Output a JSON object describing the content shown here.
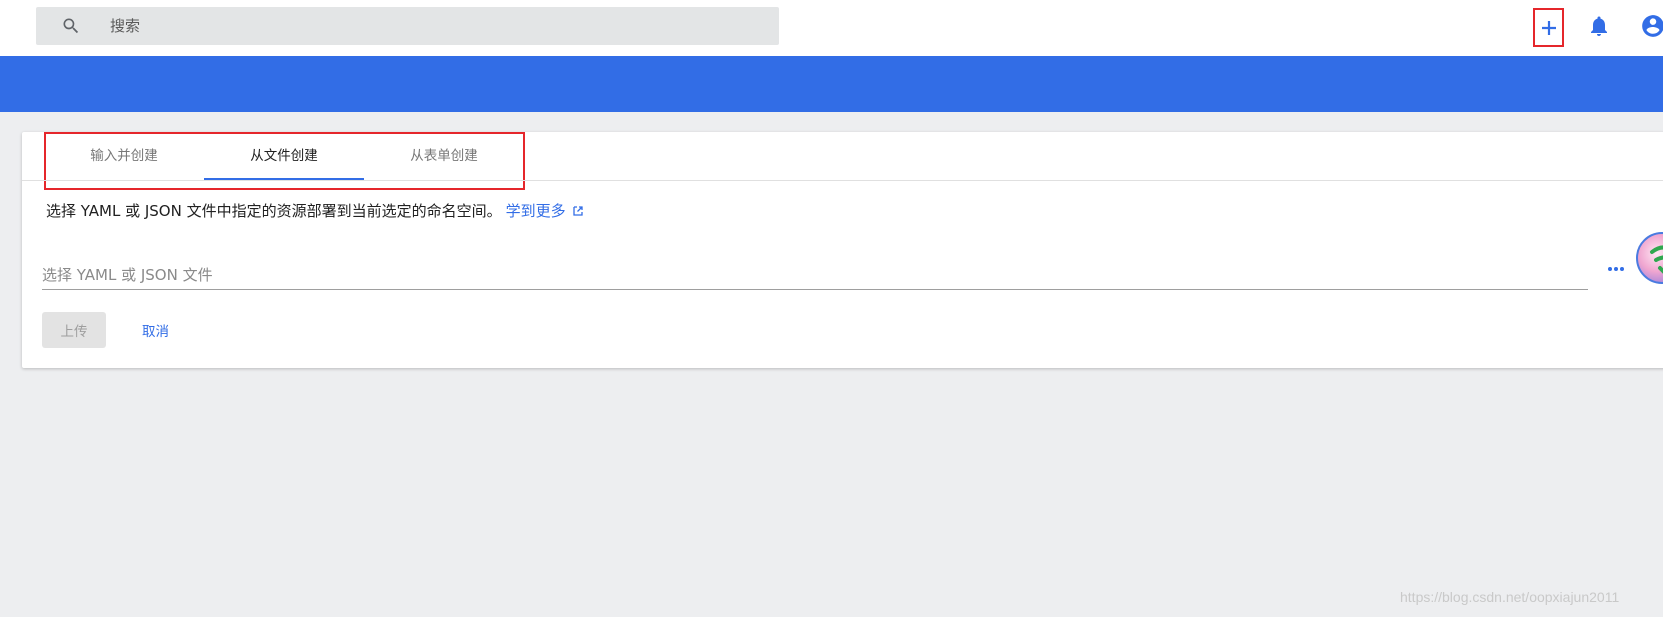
{
  "toolbar": {
    "search_placeholder": "搜索",
    "search_icon": "search-icon",
    "add_icon": "plus-icon",
    "notifications_icon": "bell-icon",
    "account_icon": "account-circle-icon"
  },
  "colors": {
    "brand": "#326de6",
    "highlight": "#e5262b",
    "background": "#edeef0"
  },
  "tabs": [
    {
      "label": "输入并创建",
      "active": false
    },
    {
      "label": "从文件创建",
      "active": true
    },
    {
      "label": "从表单创建",
      "active": false
    }
  ],
  "file_form": {
    "description": "选择 YAML 或 JSON 文件中指定的资源部署到当前选定的命名空间。",
    "learn_more": "学到更多",
    "file_placeholder": "选择 YAML 或 JSON 文件",
    "more_icon": "more-horiz-icon",
    "upload_label": "上传",
    "cancel_label": "取消"
  },
  "watermark": "https://blog.csdn.net/oopxiajun2011"
}
